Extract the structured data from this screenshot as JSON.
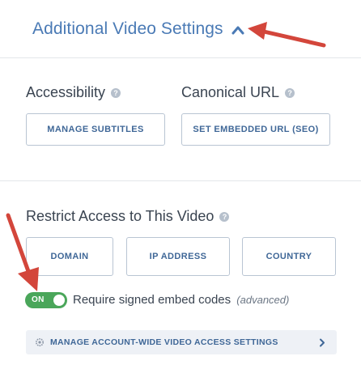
{
  "header": {
    "title": "Additional Video Settings",
    "chevron_icon": "chevron-up-icon"
  },
  "accessibility": {
    "label": "Accessibility",
    "help_icon": "help-icon",
    "button_label": "MANAGE SUBTITLES"
  },
  "canonical": {
    "label": "Canonical URL",
    "help_icon": "help-icon",
    "button_label": "SET EMBEDDED URL (SEO)"
  },
  "restrict": {
    "label": "Restrict Access to This Video",
    "help_icon": "help-icon",
    "options": [
      {
        "label": "DOMAIN"
      },
      {
        "label": "IP ADDRESS"
      },
      {
        "label": "COUNTRY"
      }
    ]
  },
  "signed_embed": {
    "toggle_state": "ON",
    "label": "Require signed embed codes",
    "hint": "(advanced)"
  },
  "account_settings": {
    "icon": "gear-icon",
    "label": "MANAGE ACCOUNT-WIDE VIDEO ACCESS SETTINGS",
    "chevron_icon": "chevron-right-icon"
  },
  "colors": {
    "accent": "#4a7ab5",
    "button_text": "#3f6797",
    "toggle_on": "#4aa65a",
    "annotation": "#d3463b"
  }
}
